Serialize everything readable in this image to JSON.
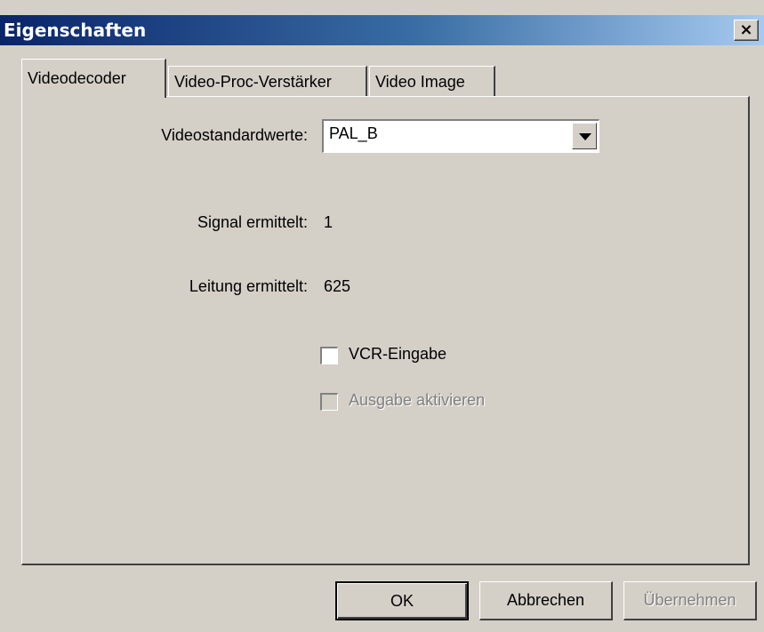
{
  "window": {
    "title": "Eigenschaften",
    "close_glyph": "×"
  },
  "tabs": [
    {
      "label": "Videodecoder",
      "active": true
    },
    {
      "label": "Video-Proc-Verstärker",
      "active": false
    },
    {
      "label": "Video Image",
      "active": false
    }
  ],
  "form": {
    "standard_label": "Videostandardwerte:",
    "standard_value": "PAL_B",
    "signal_label": "Signal ermittelt:",
    "signal_value": "1",
    "line_label": "Leitung ermittelt:",
    "line_value": "625",
    "vcr_label": "VCR-Eingabe",
    "vcr_checked": false,
    "output_label": "Ausgabe aktivieren",
    "output_checked": false,
    "output_enabled": false
  },
  "buttons": {
    "ok": "OK",
    "cancel": "Abbrechen",
    "apply": "Übernehmen"
  },
  "icons": {
    "close": "close-icon",
    "dropdown": "chevron-down-icon"
  }
}
